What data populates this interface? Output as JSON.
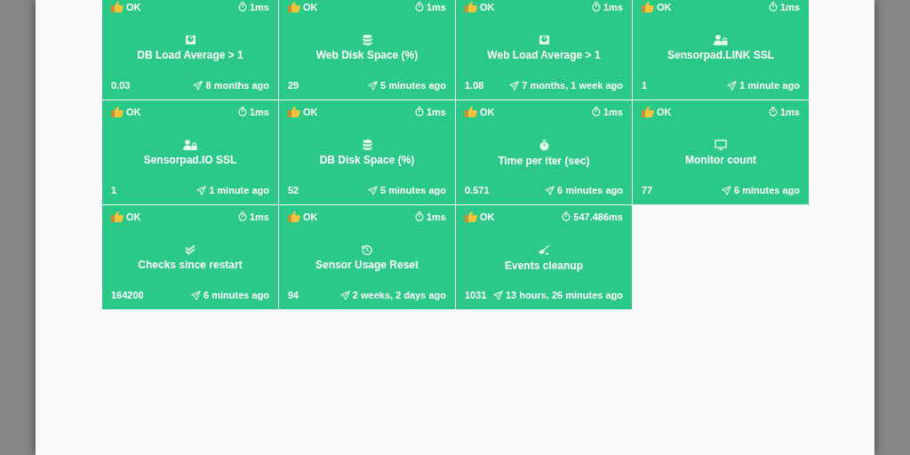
{
  "tiles": [
    {
      "status_label": "OK",
      "duration": "1ms",
      "kind": "gauge",
      "name": "DB Load Average > 1",
      "value": "0.03",
      "updated": "8 months ago"
    },
    {
      "status_label": "OK",
      "duration": "1ms",
      "kind": "database",
      "name": "Web Disk Space (%)",
      "value": "29",
      "updated": "5 minutes ago"
    },
    {
      "status_label": "OK",
      "duration": "1ms",
      "kind": "gauge",
      "name": "Web Load Average > 1",
      "value": "1.08",
      "updated": "7 months, 1 week ago"
    },
    {
      "status_label": "OK",
      "duration": "1ms",
      "kind": "user-lock",
      "name": "Sensorpad.LINK SSL",
      "value": "1",
      "updated": "1 minute ago"
    },
    {
      "status_label": "OK",
      "duration": "1ms",
      "kind": "user-lock",
      "name": "Sensorpad.IO SSL",
      "value": "1",
      "updated": "1 minute ago"
    },
    {
      "status_label": "OK",
      "duration": "1ms",
      "kind": "database",
      "name": "DB Disk Space (%)",
      "value": "52",
      "updated": "5 minutes ago"
    },
    {
      "status_label": "OK",
      "duration": "1ms",
      "kind": "stopwatch",
      "name": "Time per iter (sec)",
      "value": "0.571",
      "updated": "6 minutes ago"
    },
    {
      "status_label": "OK",
      "duration": "1ms",
      "kind": "monitor",
      "name": "Monitor count",
      "value": "77",
      "updated": "6 minutes ago"
    },
    {
      "status_label": "OK",
      "duration": "1ms",
      "kind": "double-check",
      "name": "Checks since restart",
      "value": "164200",
      "updated": "6 minutes ago"
    },
    {
      "status_label": "OK",
      "duration": "1ms",
      "kind": "history",
      "name": "Sensor Usage Reset",
      "value": "94",
      "updated": "2 weeks, 2 days ago"
    },
    {
      "status_label": "OK",
      "duration": "547.486ms",
      "kind": "broom",
      "name": "Events cleanup",
      "value": "1031",
      "updated": "13 hours, 26 minutes ago"
    }
  ]
}
